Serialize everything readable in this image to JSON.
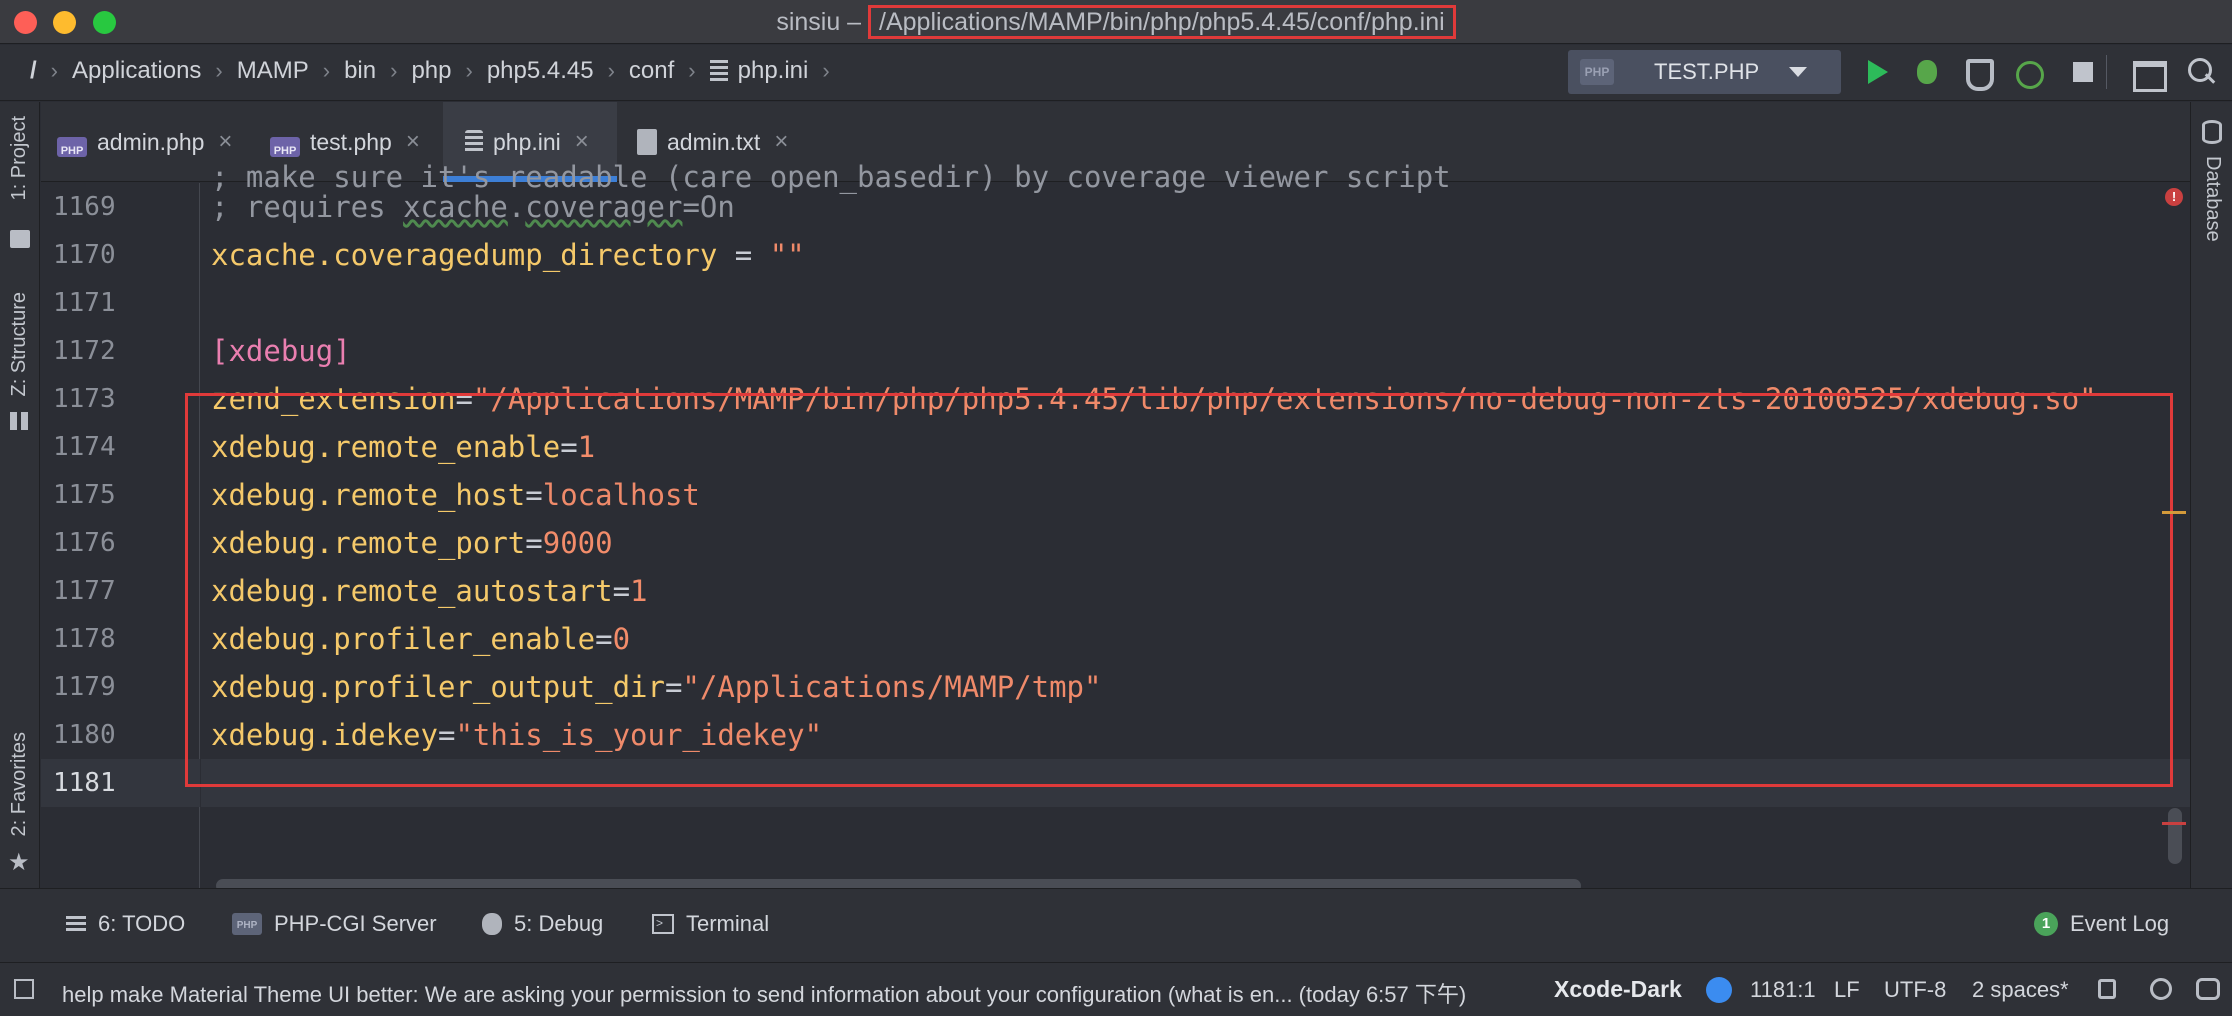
{
  "window": {
    "title_prefix": "sinsiu – ",
    "title_path": "/Applications/MAMP/bin/php/php5.4.45/conf/php.ini"
  },
  "breadcrumbs": [
    "/",
    "Applications",
    "MAMP",
    "bin",
    "php",
    "php5.4.45",
    "conf",
    "php.ini"
  ],
  "run_config": {
    "label": "TEST.PHP",
    "icon": "php-file-icon"
  },
  "tabs": [
    {
      "label": "admin.php",
      "icon": "php"
    },
    {
      "label": "test.php",
      "icon": "php"
    },
    {
      "label": "php.ini",
      "icon": "ini",
      "active": true
    },
    {
      "label": "admin.txt",
      "icon": "txt"
    }
  ],
  "tool_strip_left": {
    "project": "1: Project",
    "structure": "Z: Structure",
    "favorites": "2: Favorites"
  },
  "tool_strip_right": {
    "database": "Database"
  },
  "editor": {
    "partial_line": "; make sure it's readable (care open_basedir) by coverage viewer script",
    "lines": [
      {
        "num": "1169",
        "parts": [
          [
            "comment",
            "; requires "
          ],
          [
            "squiggle",
            "xcache"
          ],
          [
            "comment",
            "."
          ],
          [
            "squiggle",
            "coverager"
          ],
          [
            "comment",
            "=On"
          ]
        ]
      },
      {
        "num": "1170",
        "parts": [
          [
            "key",
            "xcache.coveragedump_directory"
          ],
          [
            "eq",
            " = "
          ],
          [
            "str",
            "\"\""
          ]
        ]
      },
      {
        "num": "1171",
        "parts": []
      },
      {
        "num": "1172",
        "parts": [
          [
            "sec",
            "[xdebug]"
          ]
        ]
      },
      {
        "num": "1173",
        "parts": [
          [
            "key",
            "zend_extension"
          ],
          [
            "eq",
            "="
          ],
          [
            "str",
            "\"/Applications/MAMP/bin/php/php5.4.45/lib/php/extensions/no-debug-non-zts-20100525/xdebug.so\""
          ]
        ]
      },
      {
        "num": "1174",
        "parts": [
          [
            "key",
            "xdebug.remote_enable"
          ],
          [
            "eq",
            "="
          ],
          [
            "num",
            "1"
          ]
        ]
      },
      {
        "num": "1175",
        "parts": [
          [
            "key",
            "xdebug.remote_host"
          ],
          [
            "eq",
            "="
          ],
          [
            "str",
            "localhost"
          ]
        ]
      },
      {
        "num": "1176",
        "parts": [
          [
            "key",
            "xdebug.remote_port"
          ],
          [
            "eq",
            "="
          ],
          [
            "num",
            "9000"
          ]
        ]
      },
      {
        "num": "1177",
        "parts": [
          [
            "key",
            "xdebug.remote_autostart"
          ],
          [
            "eq",
            "="
          ],
          [
            "num",
            "1"
          ]
        ]
      },
      {
        "num": "1178",
        "parts": [
          [
            "key",
            "xdebug.profiler_enable"
          ],
          [
            "eq",
            "="
          ],
          [
            "num",
            "0"
          ]
        ]
      },
      {
        "num": "1179",
        "parts": [
          [
            "key",
            "xdebug.profiler_output_dir"
          ],
          [
            "eq",
            "="
          ],
          [
            "str",
            "\"/Applications/MAMP/tmp\""
          ]
        ]
      },
      {
        "num": "1180",
        "parts": [
          [
            "key",
            "xdebug.idekey"
          ],
          [
            "eq",
            "="
          ],
          [
            "str",
            "\"this_is_your_idekey\""
          ]
        ]
      },
      {
        "num": "1181",
        "parts": [],
        "current": true
      }
    ]
  },
  "tool_windows": {
    "todo": "6: TODO",
    "cgi": "PHP-CGI Server",
    "debug": "5: Debug",
    "terminal": "Terminal",
    "event_log": "Event Log",
    "event_count": "1"
  },
  "status": {
    "message": "help make Material Theme UI better: We are asking your permission to send information about your configuration (what is en... (today 6:57 下午)",
    "theme": "Xcode-Dark",
    "position": "1181:1",
    "line_sep": "LF",
    "encoding": "UTF-8",
    "indent": "2 spaces*"
  },
  "colors": {
    "accent": "#3d7fd6",
    "highlight_box": "#e03a3a",
    "keyword": "#f5c96a",
    "string": "#ef8a6a",
    "section": "#ea7fb0"
  }
}
